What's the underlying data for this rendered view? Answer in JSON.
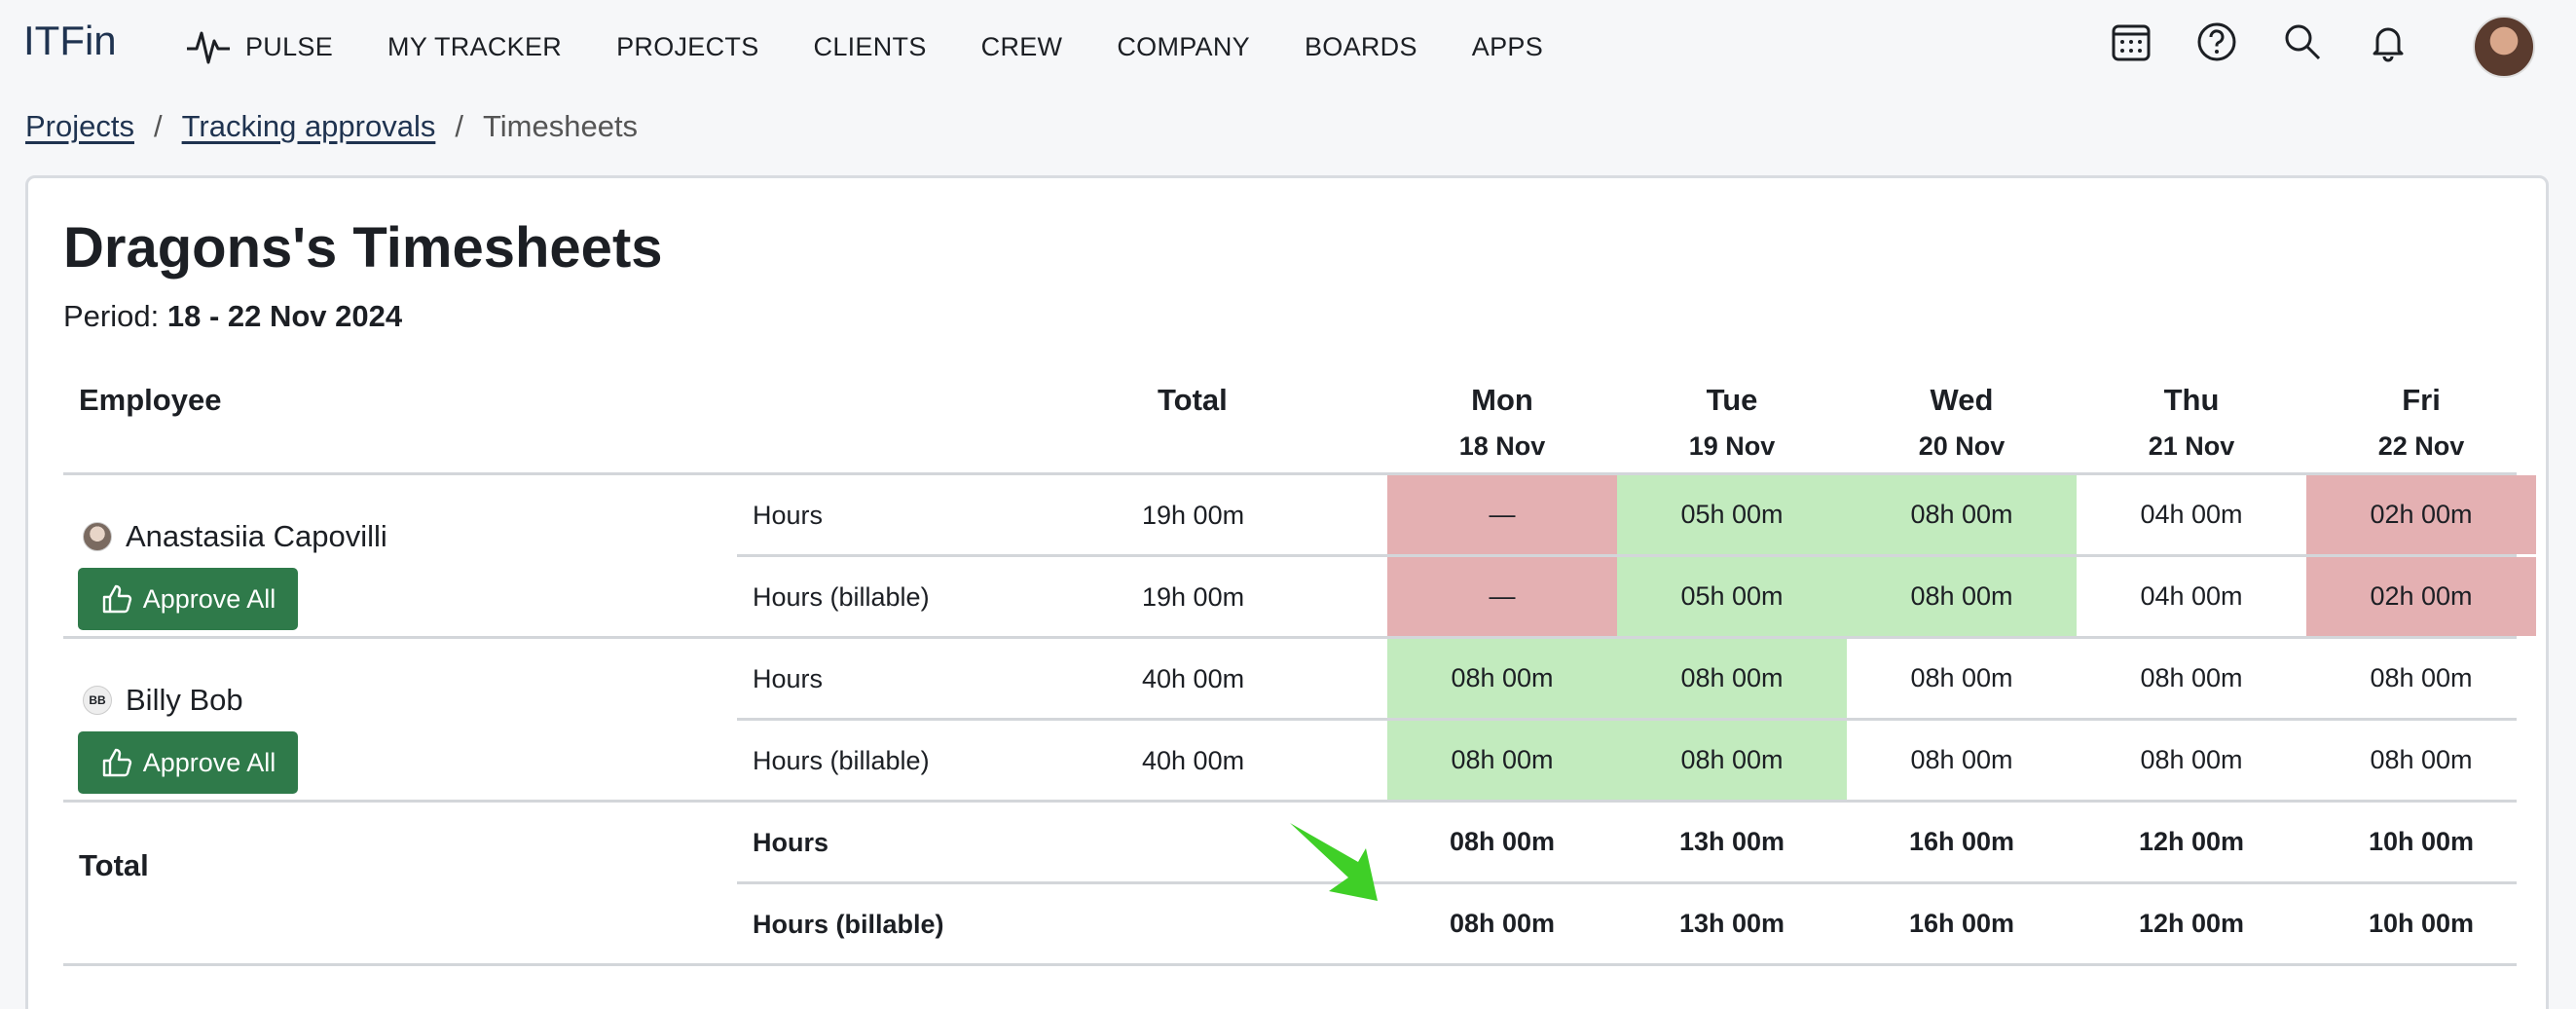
{
  "app": {
    "logo": "ITFin"
  },
  "nav": {
    "items": [
      "PULSE",
      "MY TRACKER",
      "PROJECTS",
      "CLIENTS",
      "CREW",
      "COMPANY",
      "BOARDS",
      "APPS"
    ],
    "icons": [
      "calendar-icon",
      "help-icon",
      "search-icon",
      "bell-icon"
    ]
  },
  "breadcrumb": {
    "projects": "Projects",
    "tracking": "Tracking approvals",
    "current": "Timesheets",
    "separator": "/"
  },
  "page": {
    "title": "Dragons's Timesheets",
    "period_label": "Period:",
    "period_value": "18 - 22 Nov 2024"
  },
  "table": {
    "headers": {
      "employee": "Employee",
      "total": "Total"
    },
    "days": [
      {
        "day": "Mon",
        "date": "18 Nov"
      },
      {
        "day": "Tue",
        "date": "19 Nov"
      },
      {
        "day": "Wed",
        "date": "20 Nov"
      },
      {
        "day": "Thu",
        "date": "21 Nov"
      },
      {
        "day": "Fri",
        "date": "22 Nov"
      }
    ],
    "approve_label": "Approve All",
    "employees": [
      {
        "name": "Anastasiia Capovilli",
        "initials": "",
        "rows": [
          {
            "label": "Hours",
            "total": "19h 00m",
            "values": [
              "—",
              "05h 00m",
              "08h 00m",
              "04h 00m",
              "02h 00m"
            ],
            "status": [
              "red",
              "green",
              "green",
              "none",
              "red"
            ]
          },
          {
            "label": "Hours (billable)",
            "total": "19h 00m",
            "values": [
              "—",
              "05h 00m",
              "08h 00m",
              "04h 00m",
              "02h 00m"
            ],
            "status": [
              "red",
              "green",
              "green",
              "none",
              "red"
            ]
          }
        ]
      },
      {
        "name": "Billy Bob",
        "initials": "BB",
        "rows": [
          {
            "label": "Hours",
            "total": "40h 00m",
            "values": [
              "08h 00m",
              "08h 00m",
              "08h 00m",
              "08h 00m",
              "08h 00m"
            ],
            "status": [
              "green",
              "green",
              "none",
              "none",
              "none"
            ]
          },
          {
            "label": "Hours (billable)",
            "total": "40h 00m",
            "values": [
              "08h 00m",
              "08h 00m",
              "08h 00m",
              "08h 00m",
              "08h 00m"
            ],
            "status": [
              "green",
              "green",
              "none",
              "none",
              "none"
            ]
          }
        ]
      }
    ],
    "totals": {
      "label": "Total",
      "rows": [
        {
          "label": "Hours",
          "values": [
            "08h 00m",
            "13h 00m",
            "16h 00m",
            "12h 00m",
            "10h 00m"
          ]
        },
        {
          "label": "Hours (billable)",
          "values": [
            "08h 00m",
            "13h 00m",
            "16h 00m",
            "12h 00m",
            "10h 00m"
          ]
        }
      ]
    }
  },
  "colors": {
    "approved": "#c2ebbe",
    "rejected": "#e4b0b2",
    "button": "#2f7a4a"
  }
}
